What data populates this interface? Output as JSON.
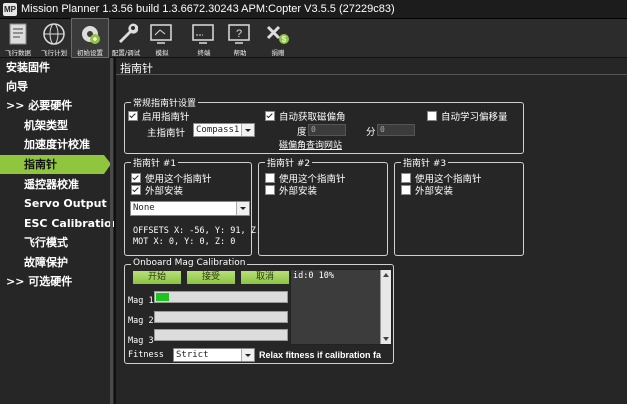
{
  "window": {
    "title": "Mission Planner 1.3.56 build 1.3.6672.30243 APM:Copter V3.5.5 (27229c83)"
  },
  "toolbar": [
    {
      "label": "飞行数据",
      "icon": "flight-data-icon"
    },
    {
      "label": "飞行计划",
      "icon": "globe-icon"
    },
    {
      "label": "初始设置",
      "icon": "setup-gear-icon"
    },
    {
      "label": "配置/调试",
      "icon": "config-wrench-icon"
    },
    {
      "label": "模拟",
      "icon": "simulation-icon"
    },
    {
      "label": "终端",
      "icon": "terminal-icon"
    },
    {
      "label": "帮助",
      "icon": "help-icon"
    },
    {
      "label": "捐赠",
      "icon": "donate-icon"
    }
  ],
  "sidebar": {
    "items": [
      {
        "label": "安装固件"
      },
      {
        "label": "向导"
      },
      {
        "label": ">> 必要硬件"
      },
      {
        "label": "机架类型"
      },
      {
        "label": "加速度计校准"
      },
      {
        "label": "指南针"
      },
      {
        "label": "遥控器校准"
      },
      {
        "label": "Servo Output"
      },
      {
        "label": "ESC Calibration"
      },
      {
        "label": "飞行模式"
      },
      {
        "label": "故障保护"
      },
      {
        "label": ">> 可选硬件"
      }
    ]
  },
  "main": {
    "title": "指南针",
    "general": {
      "group_title": "常规指南针设置",
      "enable_compass": "启用指南针",
      "enable_compass_checked": true,
      "primary_label": "主指南针",
      "primary_value": "Compass1",
      "auto_declination": "自动获取磁偏角",
      "auto_declination_checked": true,
      "degree_label": "度",
      "degree_value": "0",
      "minute_label": "分",
      "minute_value": "0",
      "auto_learn": "自动学习偏移量",
      "auto_learn_checked": false,
      "declination_link": "磁偏角查询网站"
    },
    "compass1": {
      "group_title": "指南针 #1",
      "use": "使用这个指南针",
      "use_checked": true,
      "external": "外部安装",
      "external_checked": true,
      "orientation": "None",
      "offsets": "OFFSETS  X: -56,  Y: 91,   Z:",
      "mot": "MOT        X: 0,   Y: 0,   Z: 0"
    },
    "compass2": {
      "group_title": "指南针 #2",
      "use": "使用这个指南针",
      "use_checked": false,
      "external": "外部安装",
      "external_checked": false
    },
    "compass3": {
      "group_title": "指南针 #3",
      "use": "使用这个指南针",
      "use_checked": false,
      "external": "外部安装",
      "external_checked": false
    },
    "onboard": {
      "group_title": "Onboard Mag Calibration",
      "start": "开始",
      "accept": "接受",
      "cancel": "取消",
      "log": "id:0 10%",
      "mag1_label": "Mag 1",
      "mag1_progress": 0.1,
      "mag2_label": "Mag 2",
      "mag2_progress": 0,
      "mag3_label": "Mag 3",
      "mag3_progress": 0,
      "fitness_label": "Fitness",
      "fitness_value": "Strict",
      "fitness_hint": "Relax fitness if calibration fa"
    }
  },
  "colors": {
    "accent": "#8fc63d",
    "background": "#262626",
    "progress": "#1fc21f"
  }
}
